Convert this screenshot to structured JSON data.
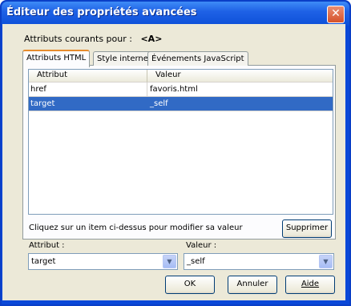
{
  "window": {
    "title": "Éditeur des propriétés avancées",
    "close_icon": "close-icon"
  },
  "current": {
    "label": "Attributs courants pour :",
    "tag": "<A>"
  },
  "tabs": [
    {
      "label": "Attributs HTML",
      "active": true
    },
    {
      "label": "Style interne",
      "active": false
    },
    {
      "label": "Événements JavaScript",
      "active": false
    }
  ],
  "table": {
    "headers": [
      "Attribut",
      "Valeur"
    ],
    "rows": [
      {
        "attribute": "href",
        "value": "favoris.html",
        "selected": false
      },
      {
        "attribute": "target",
        "value": "_self",
        "selected": true
      }
    ]
  },
  "hint": "Cliquez sur un item ci-dessus pour modifier sa valeur",
  "delete_button": "Supprimer",
  "attribute_field": {
    "label": "Attribut :",
    "value": "target"
  },
  "value_field": {
    "label": "Valeur :",
    "value": "_self"
  },
  "buttons": {
    "ok": "OK",
    "cancel": "Annuler",
    "help": "Aide"
  },
  "colors": {
    "title_bar": "#0d4fd8",
    "selection": "#316ac5",
    "active_tab_accent": "#e68b2c"
  }
}
